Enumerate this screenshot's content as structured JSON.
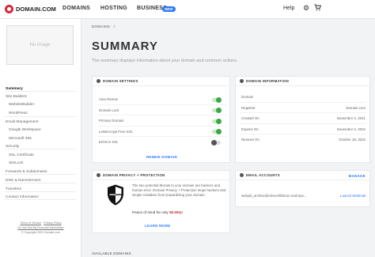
{
  "nav": {
    "logo_text": "DOMAIN.COM",
    "links": [
      "DOMAINS",
      "HOSTING",
      "BUSINESS"
    ],
    "business_badge": "NEW",
    "help": "Help"
  },
  "sidebar": {
    "image_placeholder": "No image",
    "items": [
      {
        "label": "Summary",
        "level": 0,
        "active": true
      },
      {
        "label": "Site Builders",
        "level": 0
      },
      {
        "label": "WebsiteBuilder",
        "level": 1
      },
      {
        "label": "WordPress",
        "level": 1
      },
      {
        "label": "Email Management",
        "level": 0
      },
      {
        "label": "Google Workspace",
        "level": 1
      },
      {
        "label": "Microsoft 365",
        "level": 1
      },
      {
        "label": "Security",
        "level": 0
      },
      {
        "label": "SSL Certificate",
        "level": 1
      },
      {
        "label": "SiteLock",
        "level": 1
      },
      {
        "label": "Forwards & Subdomains",
        "level": 0
      },
      {
        "label": "DNS & Nameservers",
        "level": 0
      },
      {
        "label": "Transfers",
        "level": 0
      },
      {
        "label": "Contact Information",
        "level": 0
      }
    ],
    "footer": {
      "terms": "Terms of Service",
      "privacy": "Privacy Policy",
      "dnsmp": "Do Not Sell My Personal Information",
      "copyright": "© Copyright 2021 Domain.com"
    }
  },
  "main": {
    "breadcrumb": "DOMAINS",
    "breadcrumb_sep": "/",
    "title": "SUMMARY",
    "subtitle": "The summary displays information about your domain and common actions.",
    "domain_settings": {
      "header": "DOMAIN SETTINGS",
      "rows": [
        {
          "label": "Auto Renew",
          "on": true
        },
        {
          "label": "Domain Lock",
          "on": true
        },
        {
          "label": "Primary Domain",
          "on": true
        },
        {
          "label": "LetsEncrypt Free SSL",
          "on": true
        },
        {
          "label": "Enforce SSL",
          "on": false
        }
      ],
      "action": "RENEW DOMAIN"
    },
    "domain_info": {
      "header": "DOMAIN INFORMATION",
      "rows": [
        {
          "label": "Domain",
          "value": ""
        },
        {
          "label": "Registrar",
          "value": "Domain.com"
        },
        {
          "label": "Created On",
          "value": "November 2, 2021"
        },
        {
          "label": "Expires On",
          "value": "November 2, 2022"
        },
        {
          "label": "Renews On",
          "value": "October 18, 2022"
        }
      ]
    },
    "privacy": {
      "header": "DOMAIN PRIVACY + PROTECTION",
      "body": "The two potential threats to your domain are hackers and human error. Domain Privacy + Protection stops hackers and simple mistakes from jeopardizing your domain.",
      "peace_prefix": "Peace of mind for only",
      "price": "$8.99/yr",
      "action": "LEARN MORE"
    },
    "email": {
      "header": "EMAIL ACCOUNTS",
      "manage": "MANAGE",
      "address": "webjob_archive@elevenhillstore.mail.spe...",
      "launch": "Launch Webmail"
    },
    "available_domains": "AVAILABLE DOMAINS"
  },
  "colors": {
    "brand_red": "#d7263d",
    "accent_blue": "#2979ff",
    "toggle_green": "#3aa845",
    "price_red": "#c0392b"
  }
}
